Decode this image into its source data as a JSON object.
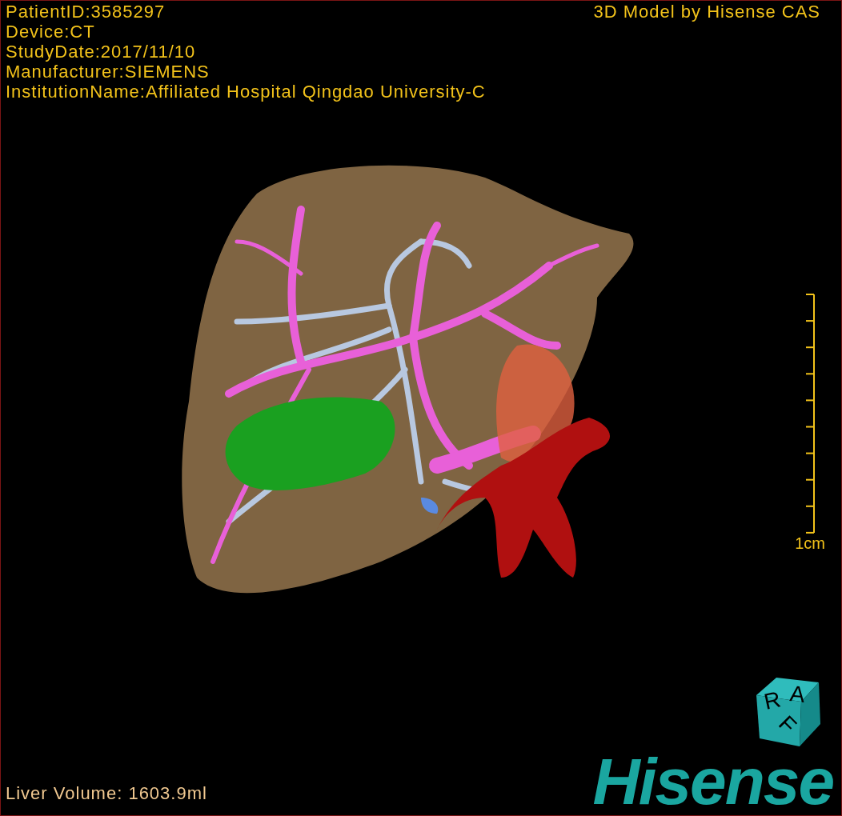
{
  "study_info": [
    "PatientID:3585297",
    "Device:CT",
    "StudyDate:2017/11/10",
    "Manufacturer:SIEMENS",
    "InstitutionName:Affiliated Hospital Qingdao University-C"
  ],
  "title": "3D Model by Hisense CAS",
  "scale_bar": {
    "label": "1cm"
  },
  "orientation_cube": {
    "letters": [
      "R",
      "A",
      "F"
    ]
  },
  "liver_volume": "Liver Volume: 1603.9ml",
  "logo": "Hisense"
}
